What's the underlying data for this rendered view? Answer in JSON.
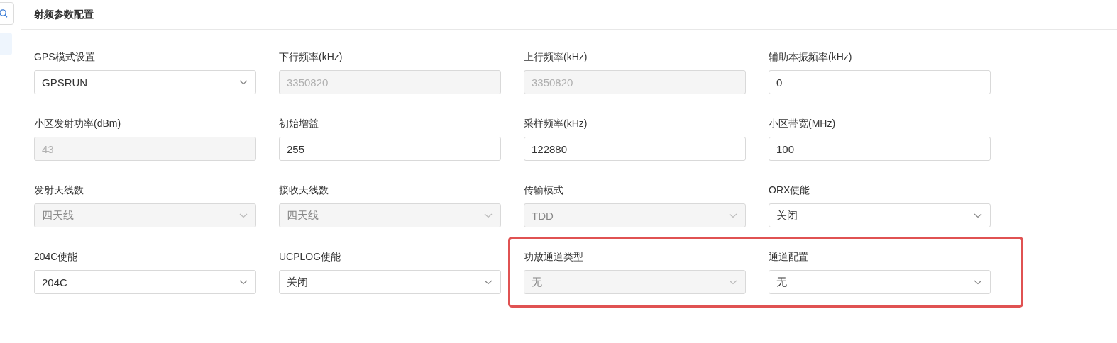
{
  "sidebar": {
    "items": [
      {
        "selected": true
      }
    ]
  },
  "section": {
    "title": "射频参数配置"
  },
  "rows": [
    [
      {
        "label": "GPS模式设置",
        "kind": "select",
        "value": "GPSRUN",
        "disabled": false,
        "highlighted": false
      },
      {
        "label": "下行频率(kHz)",
        "kind": "input",
        "value": "3350820",
        "disabled": true,
        "highlighted": false
      },
      {
        "label": "上行频率(kHz)",
        "kind": "input",
        "value": "3350820",
        "disabled": true,
        "highlighted": false
      },
      {
        "label": "辅助本振频率(kHz)",
        "kind": "input",
        "value": "0",
        "disabled": false,
        "highlighted": false
      }
    ],
    [
      {
        "label": "小区发射功率(dBm)",
        "kind": "input",
        "value": "43",
        "disabled": true,
        "highlighted": false
      },
      {
        "label": "初始增益",
        "kind": "input",
        "value": "255",
        "disabled": false,
        "highlighted": false
      },
      {
        "label": "采样频率(kHz)",
        "kind": "input",
        "value": "122880",
        "disabled": false,
        "highlighted": false
      },
      {
        "label": "小区带宽(MHz)",
        "kind": "input",
        "value": "100",
        "disabled": false,
        "highlighted": false
      }
    ],
    [
      {
        "label": "发射天线数",
        "kind": "select",
        "value": "四天线",
        "disabled": true,
        "highlighted": false
      },
      {
        "label": "接收天线数",
        "kind": "select",
        "value": "四天线",
        "disabled": true,
        "highlighted": false
      },
      {
        "label": "传输模式",
        "kind": "select",
        "value": "TDD",
        "disabled": true,
        "highlighted": false
      },
      {
        "label": "ORX使能",
        "kind": "select",
        "value": "关闭",
        "disabled": false,
        "highlighted": false
      }
    ],
    [
      {
        "label": "204C使能",
        "kind": "select",
        "value": "204C",
        "disabled": false,
        "highlighted": false
      },
      {
        "label": "UCPLOG使能",
        "kind": "select",
        "value": "关闭",
        "disabled": false,
        "highlighted": false
      },
      {
        "label": "功放通道类型",
        "kind": "select",
        "value": "无",
        "disabled": true,
        "highlighted": true
      },
      {
        "label": "通道配置",
        "kind": "select",
        "value": "无",
        "disabled": false,
        "highlighted": true
      }
    ]
  ]
}
